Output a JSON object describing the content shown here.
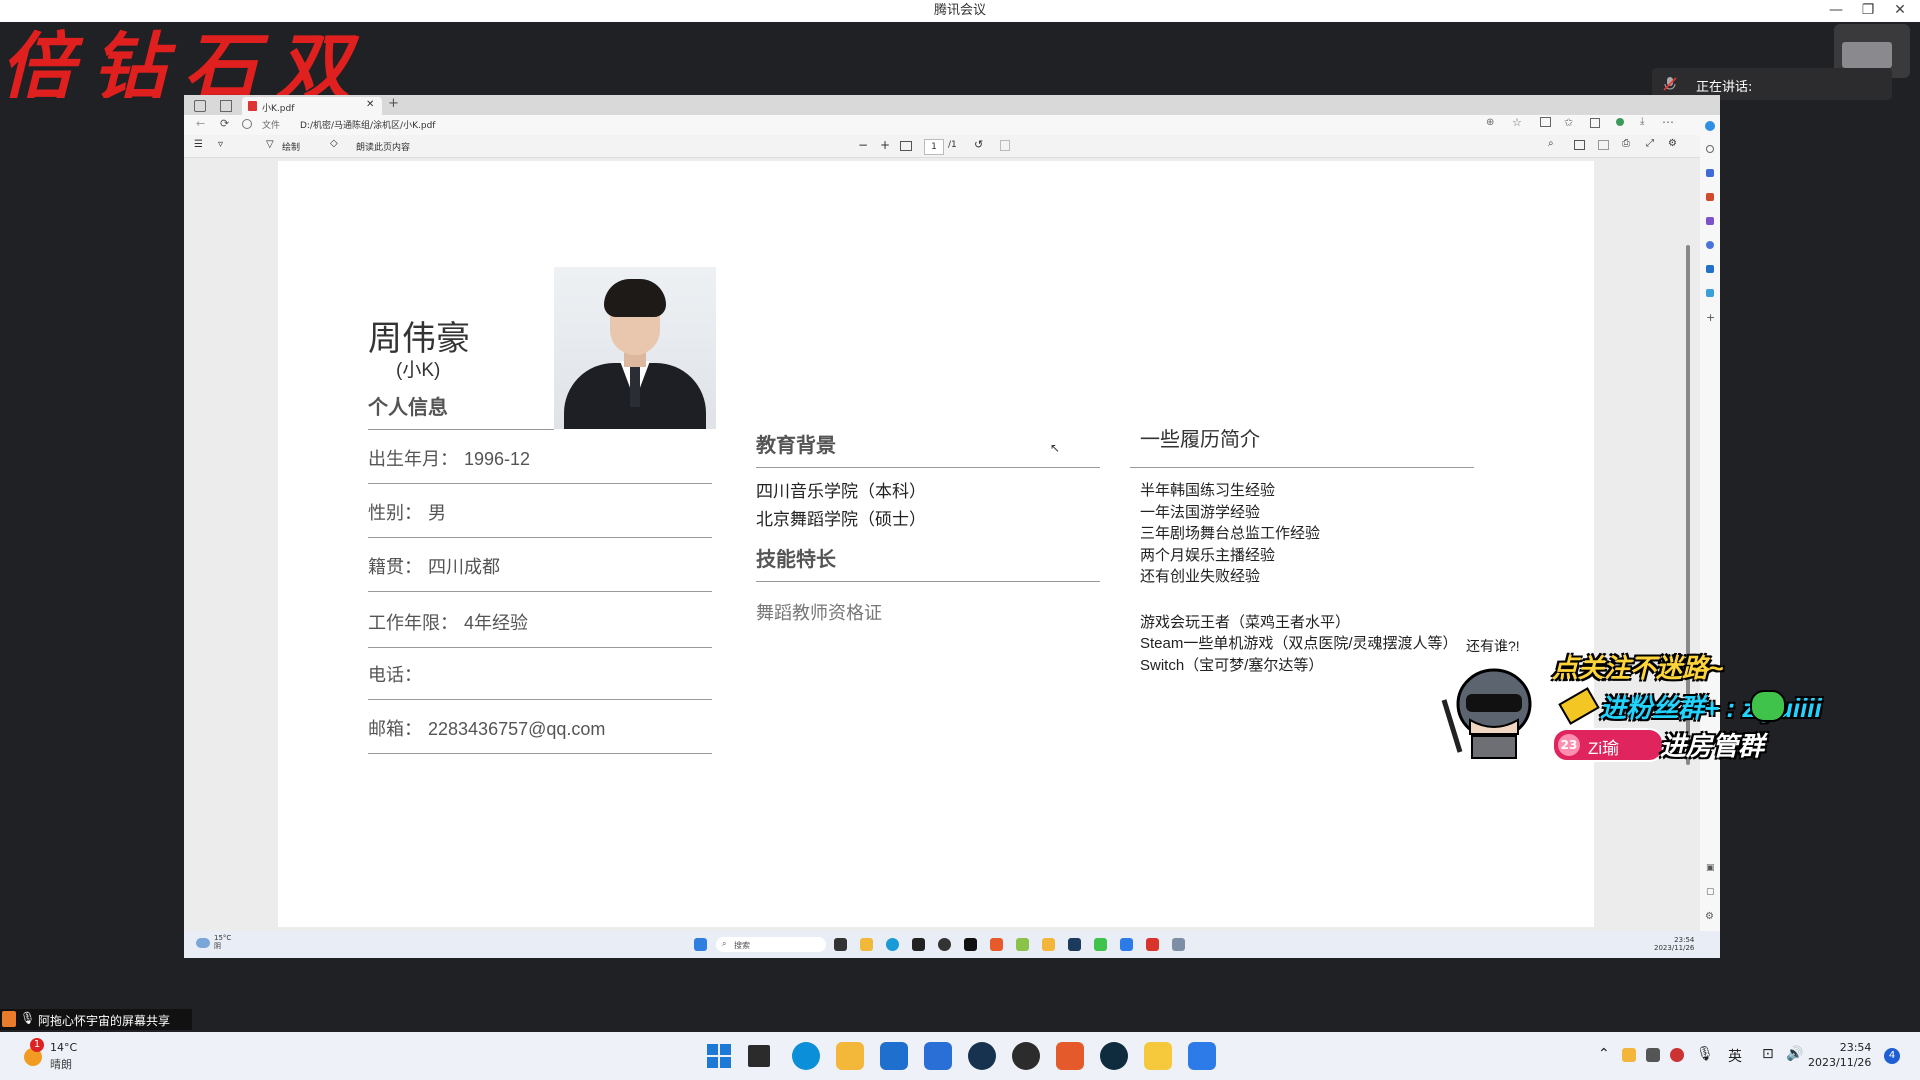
{
  "meeting": {
    "title": "腾讯会议",
    "controls": {
      "minimize": "—",
      "restore": "❐",
      "close": "✕"
    },
    "speaking_label": "正在讲话:",
    "share_label": "阿拖心怀宇宙的屏幕共享"
  },
  "overlay_banner": "倍钻石双",
  "browser": {
    "tab_title": "小K.pdf",
    "tab_close": "✕",
    "new_tab": "+",
    "address_label": "文件",
    "address": "D:/机密/马通陈组/涂机区/小K.pdf",
    "toolbar": {
      "draw_label": "绘制",
      "read_aloud_label": "朗读此页内容",
      "minus": "−",
      "plus": "+",
      "page_current": "1",
      "page_total": "/1"
    }
  },
  "resume": {
    "name": "周伟豪",
    "nickname": "(小K)",
    "personal_info_heading": "个人信息",
    "fields": [
      {
        "label": "出生年月：",
        "value": "1996-12"
      },
      {
        "label": "性别：",
        "value": "男"
      },
      {
        "label": "籍贯：",
        "value": "四川成都"
      },
      {
        "label": "工作年限：",
        "value": "4年经验"
      },
      {
        "label": "电话：",
        "value": ""
      },
      {
        "label": "邮箱：",
        "value": "2283436757@qq.com"
      }
    ],
    "education_heading": "教育背景",
    "education": [
      "四川音乐学院（本科）",
      "北京舞蹈学院（硕士）"
    ],
    "skills_heading": "技能特长",
    "skills": [
      "舞蹈教师资格证"
    ],
    "experience_heading": "一些履历简介",
    "experience": [
      "半年韩国练习生经验",
      "一年法国游学经验",
      "三年剧场舞台总监工作经验",
      "两个月娱乐主播经验",
      "还有创业失败经验"
    ],
    "hobbies": [
      "游戏会玩王者（菜鸡王者水平）",
      "Steam一些单机游戏（双点医院/灵魂摆渡人等）",
      "Switch（宝可梦/塞尔达等）"
    ]
  },
  "stream_overlay": {
    "line1": "点关注不迷路~",
    "line2": "进粉丝群+  :  ziyuiiii",
    "line3": "进房管群",
    "badge_num": "23",
    "badge_name": "Zi瑜",
    "extra": "还有谁?!"
  },
  "inner_taskbar": {
    "search": "搜索",
    "weather_temp": "15°C",
    "weather_desc": "阴",
    "time": "23:54",
    "date": "2023/11/26"
  },
  "taskbar": {
    "weather_temp": "14°C",
    "weather_desc": "晴朗",
    "weather_badge": "1",
    "ime": "英",
    "time": "23:54",
    "date": "2023/11/26",
    "notifications": "4"
  }
}
